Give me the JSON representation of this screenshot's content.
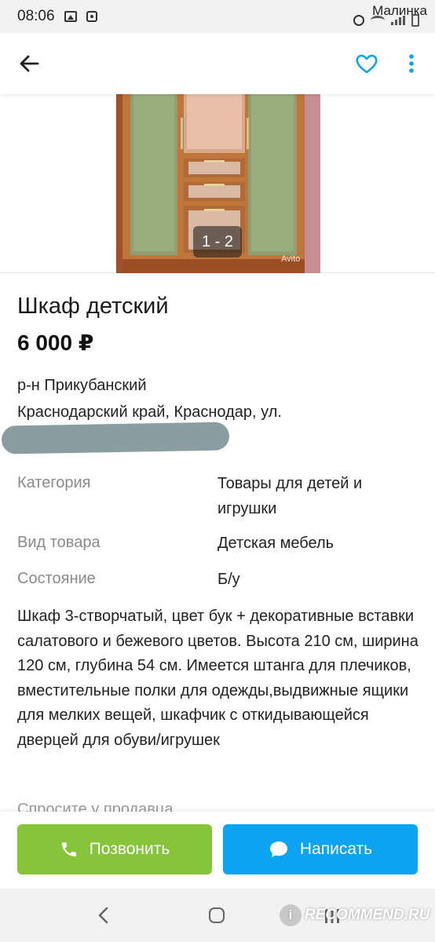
{
  "status_bar": {
    "time": "08:06",
    "carrier": "Малинка"
  },
  "listing": {
    "title": "Шкаф детский",
    "price": "6 000 ₽",
    "address_line1": "р-н Прикубанский",
    "address_line2": "Краснодарский край, Краснодар, ул."
  },
  "gallery": {
    "counter": "1 - 2",
    "watermark": "Avito"
  },
  "params": [
    {
      "label": "Категория",
      "value": "Товары для детей и игрушки"
    },
    {
      "label": "Вид товара",
      "value": "Детская мебель"
    },
    {
      "label": "Состояние",
      "value": "Б/у"
    }
  ],
  "description": "Шкаф 3-створчатый, цвет бук + декоративные вставки салатового и бежевого цветов. Высота 210 см, ширина 120 см, глубина 54 см. Имеется штанга для плечиков, вместительные полки для одежды,выдвижные ящики для мелких вещей, шкафчик с откидывающейся дверцей для обуви/игрушек",
  "ask_seller": "Спросите у продавца",
  "actions": {
    "call_label": "Позвонить",
    "write_label": "Написать"
  },
  "watermark_brand": "RECOMMEND.RU",
  "colors": {
    "call": "#86c43a",
    "write": "#0aa4f0",
    "accent": "#0aa4f0"
  },
  "icons": [
    "back-arrow-icon",
    "heart-icon",
    "more-vert-icon",
    "phone-icon",
    "chat-icon"
  ]
}
